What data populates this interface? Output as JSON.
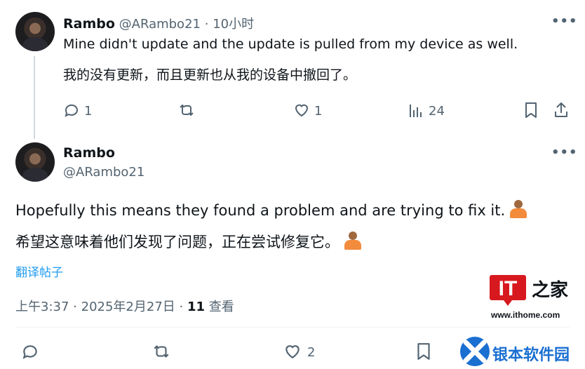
{
  "reply": {
    "name": "Rambo",
    "handle": "@ARambo21",
    "separator": "·",
    "time": "10小时",
    "text": "Mine didn't update and the update is pulled from my device as well.",
    "translation": "我的没有更新，而且更新也从我的设备中撤回了。",
    "stats": {
      "replies": "1",
      "likes": "1",
      "views": "24"
    }
  },
  "main": {
    "name": "Rambo",
    "handle": "@ARambo21",
    "text": "Hopefully this means they found a problem and are trying to fix it.",
    "translation": "希望这意味着他们发现了问题，正在尝试修复它。",
    "translate_link": "翻译帖子",
    "meta": {
      "time": "上午3:37",
      "sep1": "·",
      "date": "2025年2月27日",
      "sep2": "·",
      "views_count": "11",
      "views_label": "查看"
    },
    "stats": {
      "likes": "2"
    }
  },
  "more_label": "•••",
  "watermark": {
    "logo_text": "IT",
    "logo_suffix": "之家",
    "site": "www.ithome.com",
    "brand": "银本软件园",
    "accent": "#d7191f",
    "brand_color": "#1a6fd1"
  },
  "colors": {
    "text": "#0f1419",
    "muted": "#536471",
    "link": "#1d9bf0",
    "line": "#cfd9de"
  }
}
